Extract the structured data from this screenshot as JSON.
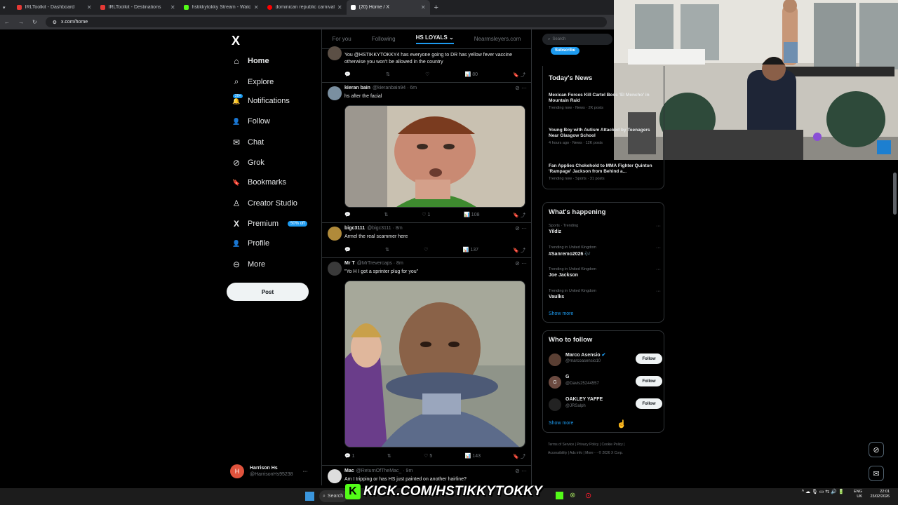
{
  "browser": {
    "tabs": [
      {
        "title": "IRLToolkit - Dashboard",
        "color": "#e53935",
        "active": false
      },
      {
        "title": "IRLToolkit - Destinations",
        "color": "#e53935",
        "active": false
      },
      {
        "title": "hstikkytokky Stream - Watch Li",
        "color": "#53fc18",
        "active": false
      },
      {
        "title": "dominican republic carnival - Y",
        "color": "#ff0000",
        "active": false
      },
      {
        "title": "(20) Home / X",
        "color": "#ffffff",
        "active": true
      }
    ],
    "new_tab": "+",
    "url": "x.com/home"
  },
  "sidebar": {
    "logo": "X",
    "items": [
      {
        "label": "Home",
        "icon": "⌂",
        "bold": true
      },
      {
        "label": "Explore",
        "icon": "⌕"
      },
      {
        "label": "Notifications",
        "icon": "🔔",
        "badge": "20+"
      },
      {
        "label": "Follow",
        "icon": "👤"
      },
      {
        "label": "Chat",
        "icon": "✉"
      },
      {
        "label": "Grok",
        "icon": "⊘"
      },
      {
        "label": "Bookmarks",
        "icon": "🔖"
      },
      {
        "label": "Creator Studio",
        "icon": "♙"
      },
      {
        "label": "Premium",
        "icon": "X",
        "badge": "50% off"
      },
      {
        "label": "Profile",
        "icon": "👤"
      },
      {
        "label": "More",
        "icon": "⊖"
      }
    ],
    "post_button": "Post",
    "account": {
      "initial": "H",
      "name": "Harrison Hs",
      "handle": "@HarrisonHs95238",
      "more": "···"
    }
  },
  "feed": {
    "tabs": [
      "For you",
      "Following",
      "HS LOYALS",
      "Nearmsleyers.com"
    ],
    "active_tab": "HS LOYALS",
    "posts": [
      {
        "name": "",
        "handle": "",
        "time": "",
        "text_mention": "@HSTIKKYTOKKY4",
        "text": "You @HSTIKKYTOKKY4 has everyone going to DR has yellow fever vaccine otherwise you won't be allowed in the country",
        "replies": "",
        "reposts": "",
        "likes": "",
        "views": "80"
      },
      {
        "name": "kieran bain",
        "handle": "@kieranbain94",
        "time": "6m",
        "text": "hs after the facial",
        "replies": "",
        "reposts": "",
        "likes": "1",
        "views": "108"
      },
      {
        "name": "bigc3111",
        "handle": "@bigc3111",
        "time": "8m",
        "text": "Armel the real scammer here",
        "replies": "",
        "reposts": "",
        "likes": "",
        "views": "137"
      },
      {
        "name": "Mr T",
        "handle": "@MrTrevercaps",
        "time": "8m",
        "text": "\"Yo H I got a sprinter plug for you\"",
        "replies": "1",
        "reposts": "",
        "likes": "5",
        "views": "143"
      },
      {
        "name": "Mac",
        "handle": "@ReturnOfTheMac_",
        "time": "9m",
        "text": "Am I tripping or has HS just painted on another hairline?",
        "replies": "",
        "reposts": "",
        "likes": "",
        "views": ""
      }
    ]
  },
  "right": {
    "search_placeholder": "Search",
    "subscribe": "Subscribe",
    "todays_news_title": "Today's News",
    "news": [
      {
        "title": "Mexican Forces Kill Cartel Boss 'El Mencho' in Mountain Raid",
        "meta": "Trending now · News · 2K posts"
      },
      {
        "title": "Young Boy with Autism Attacked by Teenagers Near Glasgow School",
        "meta": "4 hours ago · News · 12K posts"
      },
      {
        "title": "Fan Applies Chokehold to MMA Fighter Quinton 'Rampage' Jackson from Behind a...",
        "meta": "Trending now · Sports · 31 posts"
      }
    ],
    "whats_happening_title": "What's happening",
    "trends": [
      {
        "meta": "Sports · Trending",
        "name": "Yildiz"
      },
      {
        "meta": "Trending in United Kingdom",
        "name": "#Sanremo2026 🎶"
      },
      {
        "meta": "Trending in United Kingdom",
        "name": "Joe Jackson"
      },
      {
        "meta": "Trending in United Kingdom",
        "name": "Vaulks"
      }
    ],
    "show_more": "Show more",
    "who_to_follow_title": "Who to follow",
    "follow_suggestions": [
      {
        "name": "Marco Asensio",
        "handle": "@marcoasensio10",
        "verified": true,
        "initial": ""
      },
      {
        "name": "G",
        "handle": "@Davis25244557",
        "verified": false,
        "initial": "G"
      },
      {
        "name": "OAKLEY YAFFE",
        "handle": "@JRSalph",
        "verified": false,
        "initial": ""
      }
    ],
    "follow_label": "Follow",
    "footer_links": [
      "Terms of Service",
      "Privacy Policy",
      "Cookie Policy",
      "Accessibility",
      "Ads info",
      "More ···",
      "© 2026 X Corp."
    ]
  },
  "overlay": {
    "kick_text": "KICK.COM/HSTIKKYTOKKY",
    "kick_letter": "K"
  },
  "taskbar": {
    "search": "Search",
    "lang1": "ENG",
    "lang2": "UK",
    "time": "22:01",
    "date": "23/02/2026"
  }
}
